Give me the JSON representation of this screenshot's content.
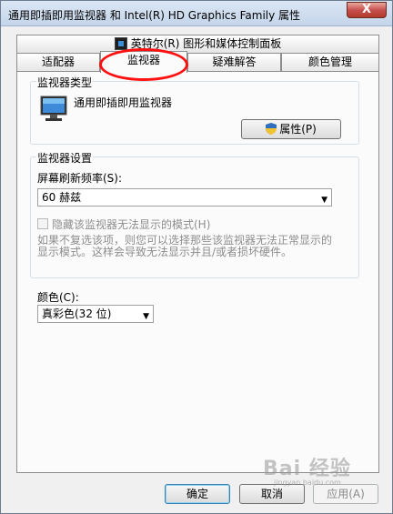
{
  "window": {
    "title": "通用即插即用监视器 和 Intel(R) HD Graphics Family 属性",
    "close_label": "X"
  },
  "tabs": {
    "top_row": [
      {
        "label": "英特尔(R) 图形和媒体控制面板",
        "icon": "intel-graphics-icon"
      }
    ],
    "bottom_row": [
      {
        "label": "适配器"
      },
      {
        "label": "监视器",
        "active": true
      },
      {
        "label": "疑难解答"
      },
      {
        "label": "颜色管理"
      }
    ]
  },
  "monitor_type": {
    "group_label": "监视器类型",
    "monitor_name": "通用即插即用监视器",
    "properties_button": "属性(P)"
  },
  "monitor_settings": {
    "group_label": "监视器设置",
    "refresh_label": "屏幕刷新频率(S):",
    "refresh_value": "60 赫兹",
    "hide_modes_label": "隐藏该监视器无法显示的模式(H)",
    "hide_modes_checked": false,
    "info_line1": "如果不复选该项，则您可以选择那些该监视器无法正常显示的",
    "info_line2": "显示模式。这样会导致无法显示并且/或者损坏硬件。"
  },
  "color": {
    "label": "颜色(C):",
    "value": "真彩色(32 位)"
  },
  "footer": {
    "ok": "确定",
    "cancel": "取消",
    "apply": "应用(A)"
  },
  "colors": {
    "annotation": "#ff1010",
    "window_bg": "#f0f0f0",
    "panel_bg": "#fbfbfb"
  },
  "watermark": {
    "text": "Bai 经验",
    "sub": "jingyan.baidu.com"
  }
}
